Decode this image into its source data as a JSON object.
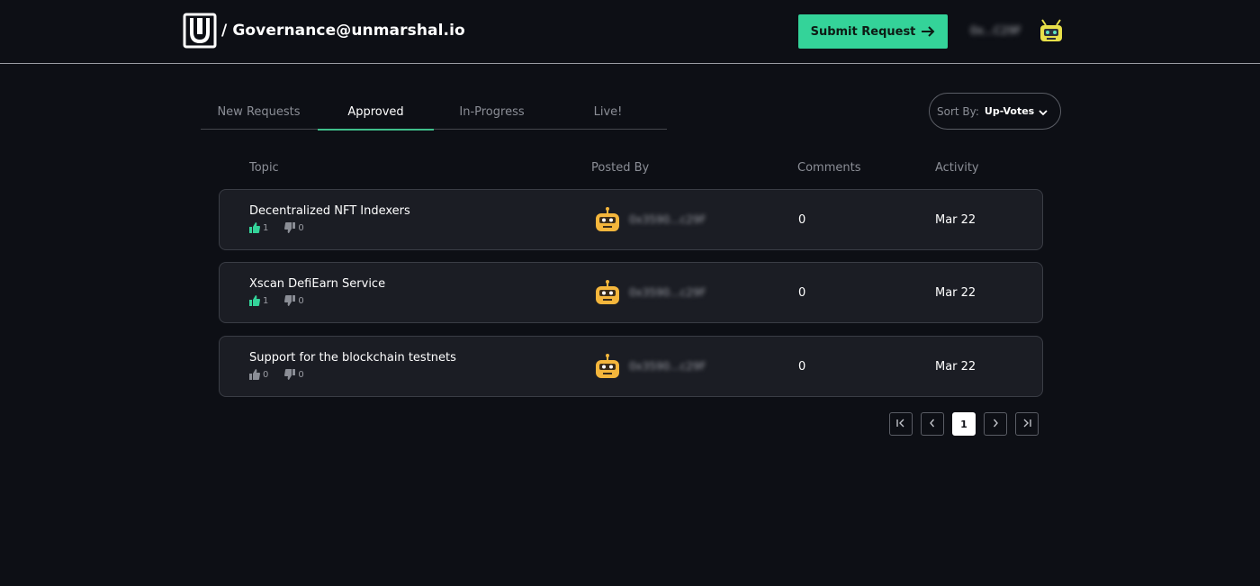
{
  "header": {
    "title": "/ Governance@unmarshal.io",
    "submit_label": "Submit Request",
    "wallet_address": "0x...C29F"
  },
  "tabs": [
    {
      "label": "New Requests",
      "active": false
    },
    {
      "label": "Approved",
      "active": true
    },
    {
      "label": "In-Progress",
      "active": false
    },
    {
      "label": "Live!",
      "active": false
    }
  ],
  "sort": {
    "label": "Sort By:",
    "value": "Up-Votes"
  },
  "columns": {
    "topic": "Topic",
    "posted_by": "Posted By",
    "comments": "Comments",
    "activity": "Activity"
  },
  "rows": [
    {
      "title": "Decentralized NFT Indexers",
      "upvotes": "1",
      "downvotes": "0",
      "upvoted": true,
      "poster": "0x3590...c29F",
      "comments": "0",
      "activity": "Mar 22"
    },
    {
      "title": "Xscan DefiEarn Service",
      "upvotes": "1",
      "downvotes": "0",
      "upvoted": true,
      "poster": "0x3590...c29F",
      "comments": "0",
      "activity": "Mar 22"
    },
    {
      "title": "Support for the blockchain testnets",
      "upvotes": "0",
      "downvotes": "0",
      "upvoted": false,
      "poster": "0x3590...c29F",
      "comments": "0",
      "activity": "Mar 22"
    }
  ],
  "pagination": {
    "current_page": "1"
  },
  "colors": {
    "accent": "#34d399",
    "background": "#0d0f15",
    "card": "#1b1d24",
    "avatar": "#f4b63c"
  }
}
